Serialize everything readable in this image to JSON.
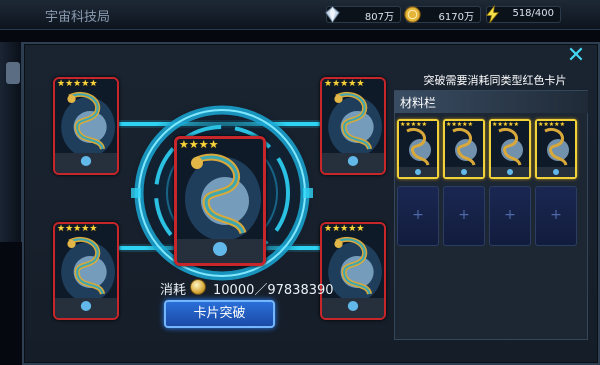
{
  "top_bar": {
    "title": "宇宙科技局",
    "resources": [
      {
        "icon": "crystal-icon",
        "value": "807万"
      },
      {
        "icon": "gold-coin-icon",
        "value": "6170万"
      },
      {
        "icon": "energy-bolt-icon",
        "value": "518/400"
      }
    ]
  },
  "dialog": {
    "hint": "突破需要消耗同类型红色卡片",
    "panel_title": "材料栏",
    "cost_label": "消耗",
    "cost_icon": "gold-coin-icon",
    "cost_value": "10000／97838390",
    "break_button": "卡片突破",
    "close_icon": "close-icon"
  },
  "cards": {
    "main": {
      "stars": 4,
      "frame_color": "#c7262a",
      "art": "golden-dragon-icon"
    },
    "surrounding": [
      {
        "stars": 5
      },
      {
        "stars": 5
      },
      {
        "stars": 5
      },
      {
        "stars": 5
      }
    ]
  },
  "material_slots": {
    "filled": [
      {
        "stars": 5
      },
      {
        "stars": 5
      },
      {
        "stars": 5
      },
      {
        "stars": 5
      }
    ],
    "empty_count": 4,
    "empty_icon": "plus-icon"
  },
  "colors": {
    "accent_cyan": "#2fd3f5",
    "card_frame_red": "#c7262a",
    "slot_frame_gold": "#f1d23a",
    "button_blue": "#2a6fd8"
  }
}
